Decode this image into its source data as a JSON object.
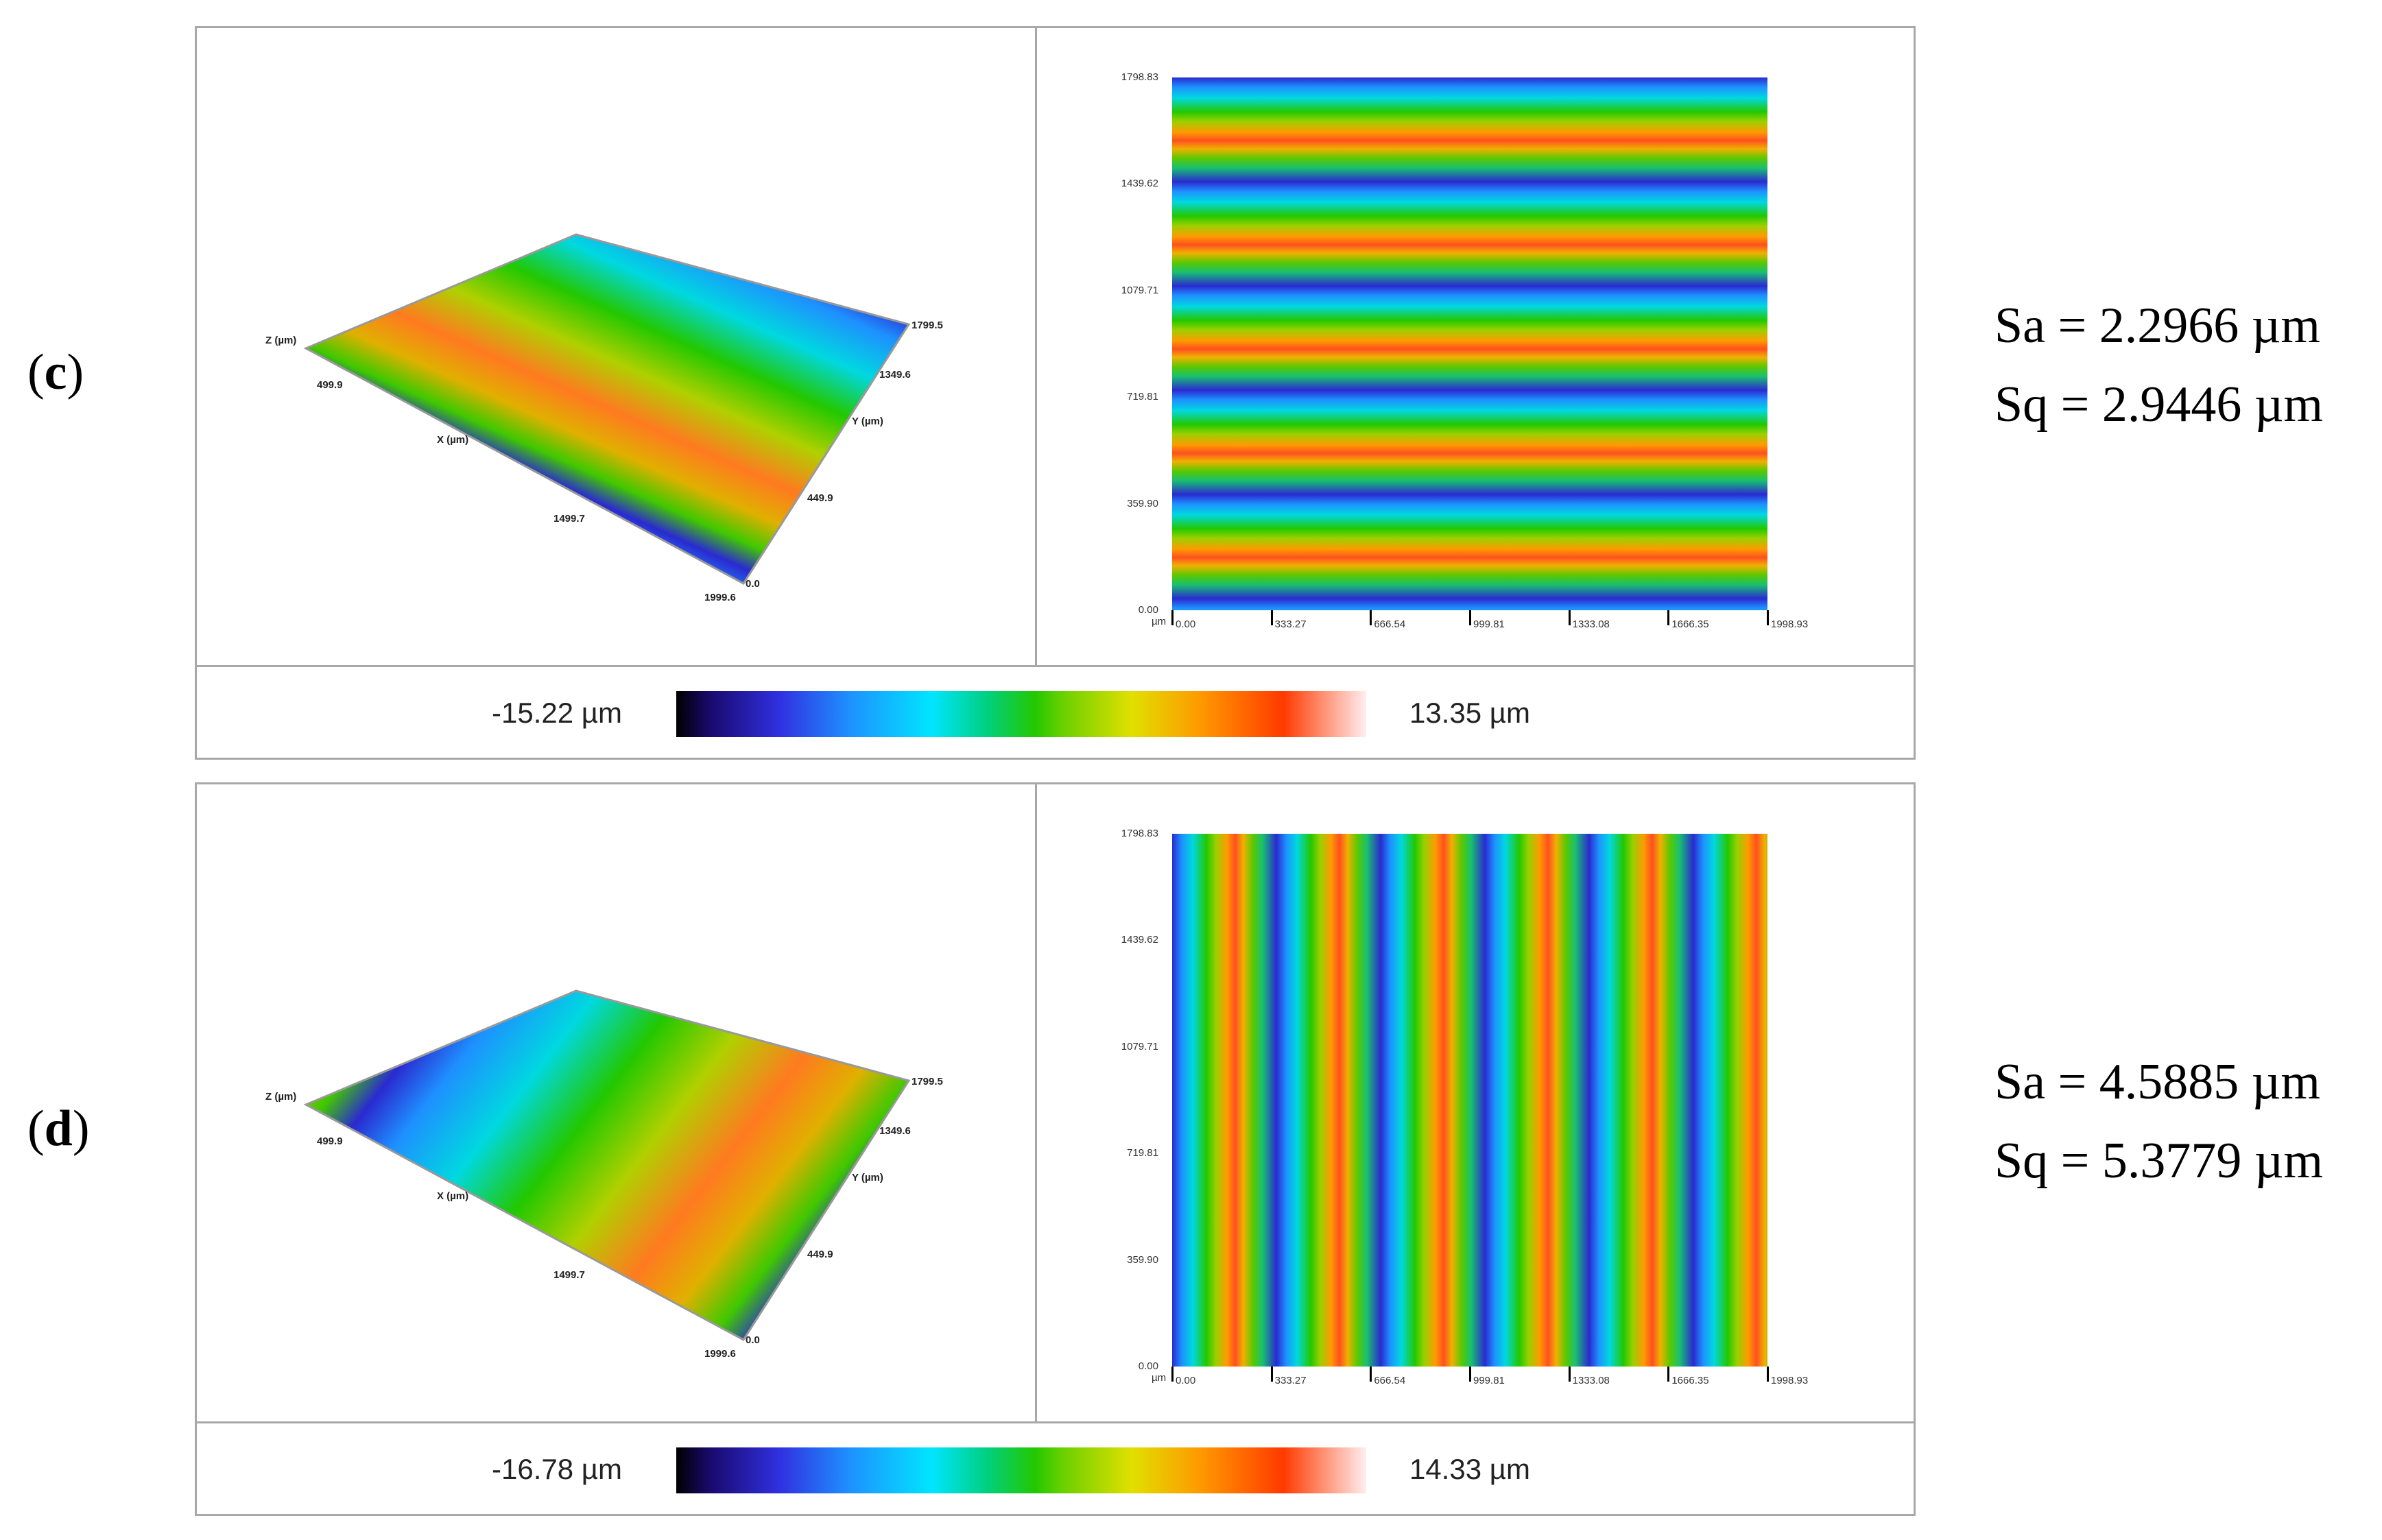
{
  "unit": "µm",
  "yticks": [
    "1798.83",
    "1439.62",
    "1079.71",
    "719.81",
    "359.90",
    "0.00"
  ],
  "xticks": [
    "0.00",
    "333.27",
    "666.54",
    "999.81",
    "1333.08",
    "1666.35",
    "1998.93"
  ],
  "axes3d": {
    "z": "Z (µm)",
    "x": "X (µm)",
    "y": "Y (µm)",
    "x1": "499.9",
    "x2": "1499.7",
    "x3": "1999.6",
    "y0": "0.0",
    "y1": "449.9",
    "y2": "1349.6",
    "y3": "1799.5"
  },
  "panels": [
    {
      "label_open": "(",
      "label": "c",
      "label_close": ")",
      "min": "-15.22 µm",
      "max": "13.35 µm",
      "sa": "Sa = 2.2966 µm",
      "sq": "Sq = 2.9446 µm",
      "orientation": "horizontal"
    },
    {
      "label_open": "(",
      "label": "d",
      "label_close": ")",
      "min": "-16.78 µm",
      "max": "14.33 µm",
      "sa": "Sa = 4.5885 µm",
      "sq": "Sq = 5.3779 µm",
      "orientation": "vertical"
    }
  ]
}
